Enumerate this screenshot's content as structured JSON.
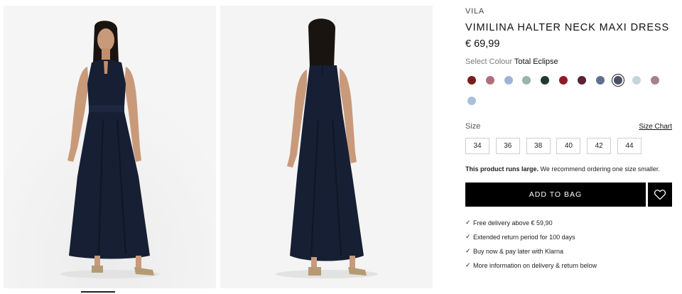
{
  "product": {
    "brand": "VILA",
    "title": "VIMILINA HALTER NECK MAXI DRESS",
    "price": "€ 69,99"
  },
  "colour": {
    "label": "Select Colour",
    "selected_name": "Total Eclipse",
    "swatches": [
      {
        "color": "#7b1c1c"
      },
      {
        "color": "#b06e7d"
      },
      {
        "color": "#9fb3d6"
      },
      {
        "color": "#9bb3aa"
      },
      {
        "color": "#1f3a2e"
      },
      {
        "color": "#8e1b24"
      },
      {
        "color": "#5a2233"
      },
      {
        "color": "#5d7090"
      },
      {
        "color": "#4a4f69",
        "selected": true
      },
      {
        "color": "#c6d5dc"
      },
      {
        "color": "#a58289"
      },
      {
        "color": "#a9c0d9"
      }
    ]
  },
  "size": {
    "label": "Size",
    "chart_link": "Size Chart",
    "options": [
      "34",
      "36",
      "38",
      "40",
      "42",
      "44"
    ]
  },
  "fit_note": {
    "bold": "This product runs large.",
    "text": " We recommend ordering one size smaller."
  },
  "actions": {
    "add_to_bag": "ADD TO BAG",
    "wishlist_icon": "heart-icon"
  },
  "benefits": [
    "Free delivery above € 59,90",
    "Extended return period for 100 days",
    "Buy now & pay later with Klarna",
    "More information on delivery & return below"
  ],
  "images": {
    "front_icon": "dress-front-photo",
    "back_icon": "dress-back-photo"
  },
  "colors": {
    "dress": "#161f33",
    "button_bg": "#000000",
    "button_text": "#ffffff",
    "image_bg": "#f4f4f4"
  }
}
